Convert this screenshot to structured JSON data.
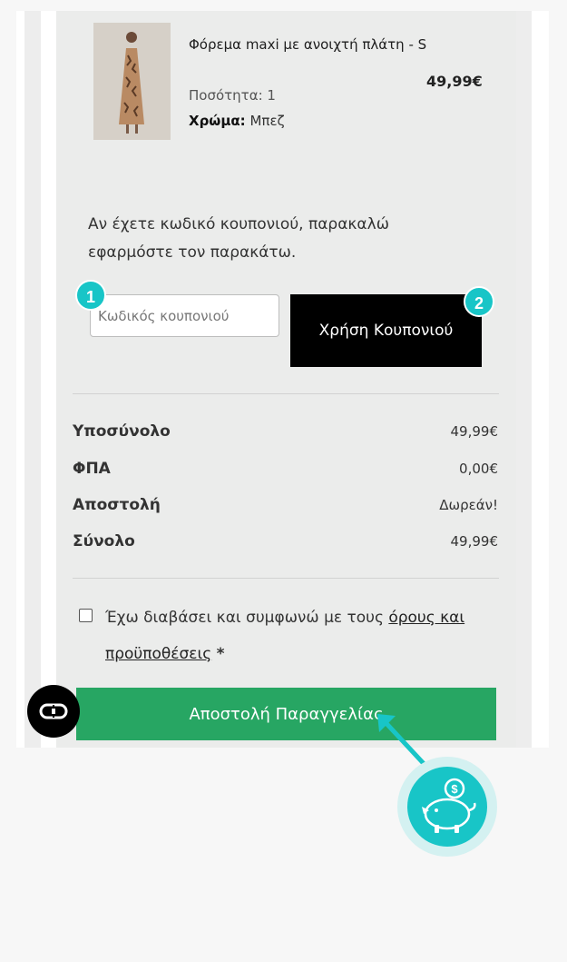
{
  "product": {
    "name": "Φόρεμα maxi με ανοιχτή πλάτη - S",
    "quantity": "Ποσότητα: 1",
    "color_label": "Χρώμα:",
    "color_value": "Μπεζ",
    "price": "49,99€"
  },
  "coupon": {
    "intro": "Αν έχετε κωδικό κουπονιού, παρακαλώ εφαρμόστε τον παρακάτω.",
    "placeholder": "Κωδικός κουπονιού",
    "apply_label": "Χρήση Κουπονιού",
    "step_1": "1",
    "step_2": "2"
  },
  "summary": {
    "subtotal_label": "Υποσύνολο",
    "subtotal_value": "49,99€",
    "vat_label": "ΦΠΑ",
    "vat_value": "0,00€",
    "shipping_label": "Αποστολή",
    "shipping_value": "Δωρεάν!",
    "total_label": "Σύνολο",
    "total_value": "49,99€"
  },
  "terms": {
    "text": "Έχω διαβάσει και συμφωνώ με τους",
    "link": "όρους και προϋποθέσεις",
    "required": "*"
  },
  "order": {
    "submit_label": "Αποστολή Παραγγελίας"
  },
  "icons": {
    "float": "glasses-icon",
    "piggy": "piggy-bank-icon"
  },
  "colors": {
    "accent": "#18c5c7",
    "submit": "#27a663",
    "apply": "#000000"
  }
}
